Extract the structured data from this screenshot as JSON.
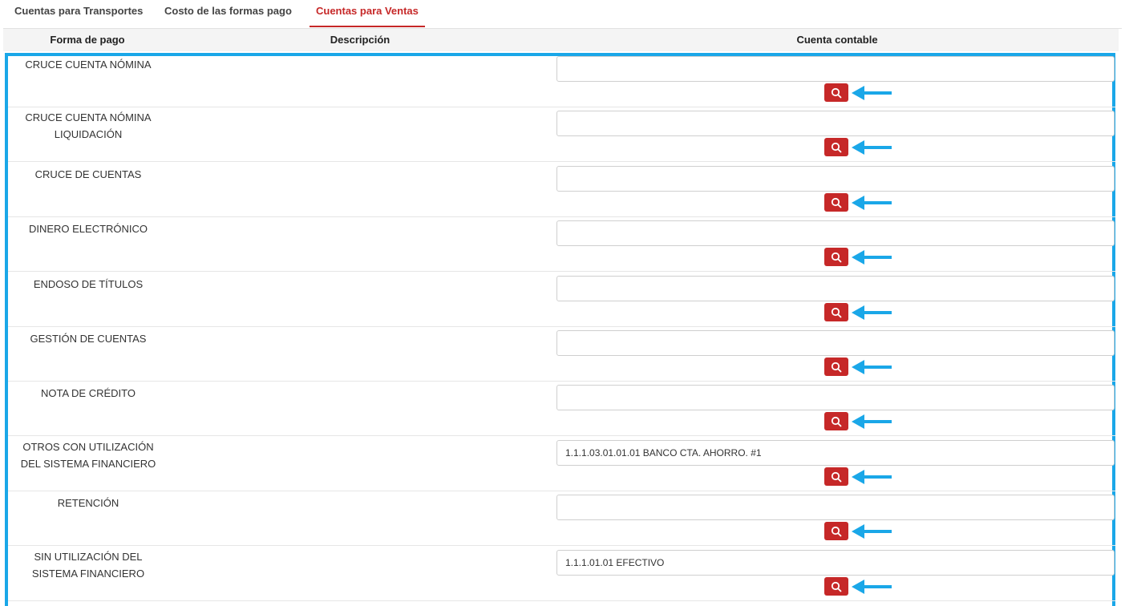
{
  "tabs": [
    {
      "label": "Cuentas para Transportes",
      "active": false
    },
    {
      "label": "Costo de las formas pago",
      "active": false
    },
    {
      "label": "Cuentas para Ventas",
      "active": true
    }
  ],
  "table": {
    "headers": {
      "forma_pago": "Forma de pago",
      "descripcion": "Descripción",
      "cuenta_contable": "Cuenta contable"
    },
    "rows": [
      {
        "forma_pago": [
          "CRUCE CUENTA NÓMINA"
        ],
        "cuenta": ""
      },
      {
        "forma_pago": [
          "CRUCE CUENTA NÓMINA",
          "LIQUIDACIÓN"
        ],
        "cuenta": ""
      },
      {
        "forma_pago": [
          "CRUCE DE CUENTAS"
        ],
        "cuenta": ""
      },
      {
        "forma_pago": [
          "DINERO ELECTRÓNICO"
        ],
        "cuenta": ""
      },
      {
        "forma_pago": [
          "ENDOSO DE TÍTULOS"
        ],
        "cuenta": ""
      },
      {
        "forma_pago": [
          "GESTIÓN DE CUENTAS"
        ],
        "cuenta": ""
      },
      {
        "forma_pago": [
          "NOTA DE CRÉDITO"
        ],
        "cuenta": ""
      },
      {
        "forma_pago": [
          "OTROS CON UTILIZACIÓN",
          "DEL SISTEMA FINANCIERO"
        ],
        "cuenta": "1.1.1.03.01.01.01 BANCO CTA. AHORRO. #1"
      },
      {
        "forma_pago": [
          "RETENCIÓN"
        ],
        "cuenta": ""
      },
      {
        "forma_pago": [
          "SIN UTILIZACIÓN DEL",
          "SISTEMA FINANCIERO"
        ],
        "cuenta": "1.1.1.01.01 EFECTIVO"
      }
    ]
  },
  "icons": {
    "search": "magnifier-icon",
    "annotation": "left-arrow-icon"
  },
  "colors": {
    "accent": "#c62828",
    "highlight": "#1aa7e8"
  }
}
